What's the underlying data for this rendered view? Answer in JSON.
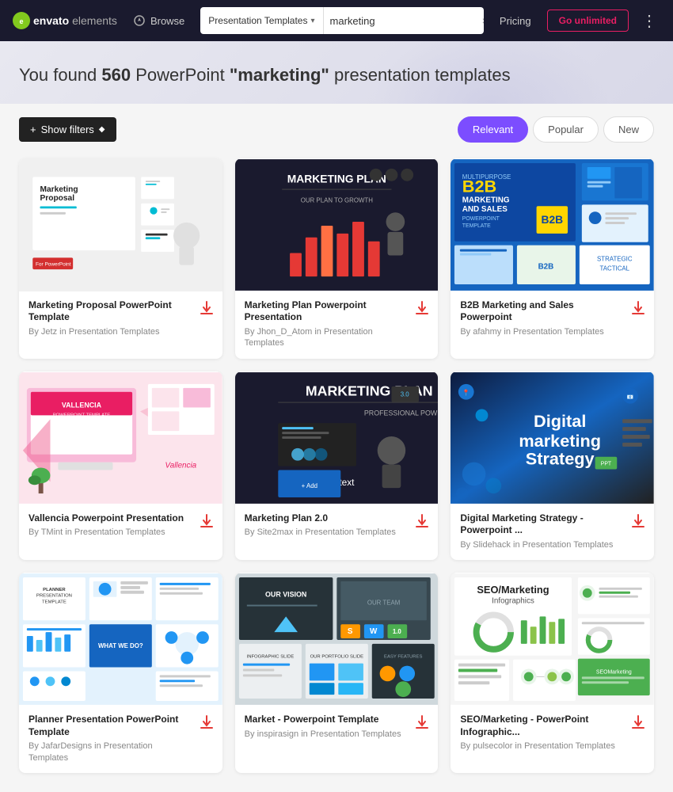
{
  "header": {
    "logo_icon": "e",
    "logo_brand": "envato",
    "logo_suffix": "elements",
    "browse_label": "Browse",
    "search_category": "Presentation Templates",
    "search_value": "marketing",
    "search_clear": "×",
    "search_icon": "🔍",
    "pricing_label": "Pricing",
    "go_unlimited_label": "Go unlimited",
    "more_icon": "⋮"
  },
  "hero": {
    "prefix": "You found ",
    "count": "560",
    "middle": " PowerPoint ",
    "query": "\"marketing\"",
    "suffix": " presentation templates"
  },
  "toolbar": {
    "show_filters_label": "Show filters",
    "sort_options": [
      {
        "label": "Relevant",
        "active": true
      },
      {
        "label": "Popular",
        "active": false
      },
      {
        "label": "New",
        "active": false
      }
    ]
  },
  "cards": [
    {
      "id": 1,
      "title": "Marketing Proposal PowerPoint Template",
      "author": "Jetz",
      "category": "Presentation Templates",
      "thumb_type": "marketing-proposal"
    },
    {
      "id": 2,
      "title": "Marketing Plan Powerpoint Presentation",
      "author": "Jhon_D_Atom",
      "category": "Presentation Templates",
      "thumb_type": "marketing-plan-dark"
    },
    {
      "id": 3,
      "title": "B2B Marketing and Sales Powerpoint",
      "author": "afahmy",
      "category": "Presentation Templates",
      "thumb_type": "b2b-marketing"
    },
    {
      "id": 4,
      "title": "Vallencia Powerpoint Presentation",
      "author": "TMint",
      "category": "Presentation Templates",
      "thumb_type": "vallencia"
    },
    {
      "id": 5,
      "title": "Marketing Plan 2.0",
      "author": "Site2max",
      "category": "Presentation Templates",
      "thumb_type": "marketing-plan-2"
    },
    {
      "id": 6,
      "title": "Digital Marketing Strategy - Powerpoint ...",
      "author": "Slidehack",
      "category": "Presentation Templates",
      "thumb_type": "digital-marketing"
    },
    {
      "id": 7,
      "title": "Planner Presentation PowerPoint Template",
      "author": "JafarDesigns",
      "category": "Presentation Templates",
      "thumb_type": "planner"
    },
    {
      "id": 8,
      "title": "Market - Powerpoint Template",
      "author": "inspirasign",
      "category": "Presentation Templates",
      "thumb_type": "market"
    },
    {
      "id": 9,
      "title": "SEO/Marketing - PowerPoint Infographic...",
      "author": "pulsecolor",
      "category": "Presentation Templates",
      "thumb_type": "seo-marketing"
    }
  ],
  "icons": {
    "download": "↓",
    "plus": "+",
    "tag": "◆",
    "chevron_down": "▾",
    "search": "🔍"
  }
}
